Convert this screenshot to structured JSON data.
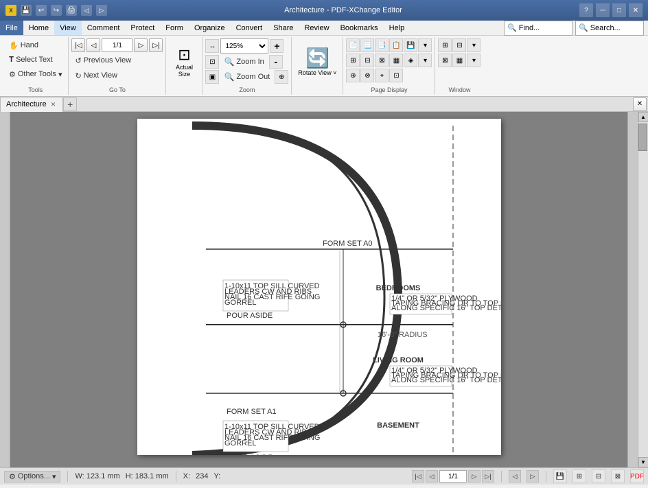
{
  "titlebar": {
    "title": "Architecture - PDF-XChange Editor",
    "app_icon": "✕",
    "min_label": "─",
    "max_label": "□",
    "close_label": "✕"
  },
  "menubar": {
    "items": [
      "File",
      "Home",
      "View",
      "Comment",
      "Protect",
      "Form",
      "Organize",
      "Convert",
      "Share",
      "Review",
      "Bookmarks",
      "Help"
    ]
  },
  "ribbon": {
    "active_tab": "View",
    "tabs": [
      "File",
      "Home",
      "View",
      "Comment",
      "Protect",
      "Form",
      "Organize",
      "Convert",
      "Share",
      "Review",
      "Bookmarks",
      "Help"
    ],
    "find_label": "Find...",
    "search_label": "Search...",
    "tools_group": {
      "label": "Tools",
      "hand_label": "Hand",
      "select_text_label": "Select Text",
      "other_tools_label": "Other Tools"
    },
    "goto_group": {
      "label": "Go To",
      "page_value": "1/1",
      "prev_view_label": "Previous View",
      "next_view_label": "Next View"
    },
    "zoom_group": {
      "label": "Zoom",
      "zoom_level": "125%",
      "zoom_in_label": "Zoom In",
      "zoom_out_label": "Zoom Out",
      "actual_size_label": "Actual Size"
    },
    "rotate_group": {
      "rotate_view_label": "Rotate View ˅"
    },
    "page_display_group": {
      "label": "Page Display"
    },
    "window_group": {
      "label": "Window"
    }
  },
  "document": {
    "tab_name": "Architecture",
    "page_current": "1",
    "page_total": "1",
    "page_display": "1/1"
  },
  "statusbar": {
    "options_label": "Options...",
    "width_label": "W: 123.1 mm",
    "height_label": "H: 183.1 mm",
    "x_label": "X:",
    "y_label": "Y:",
    "page_nav": "1/1"
  },
  "drawing": {
    "room_labels": [
      "BEDROOMS",
      "LIVING ROOM",
      "BASEMENT"
    ]
  }
}
